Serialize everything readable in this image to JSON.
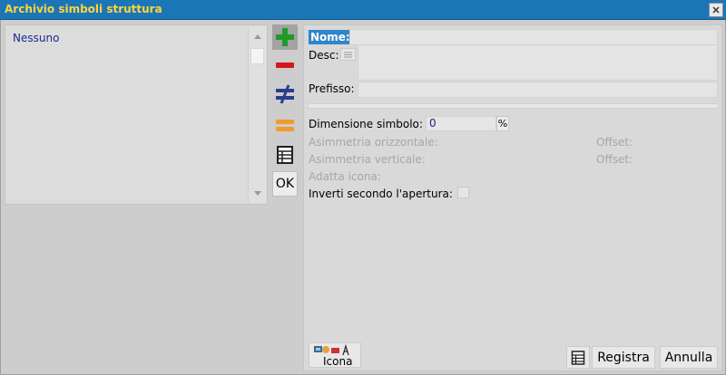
{
  "window": {
    "title": "Archivio simboli struttura"
  },
  "list": {
    "items": [
      "Nessuno"
    ]
  },
  "toolbar": {
    "ok_label": "OK"
  },
  "form": {
    "name_label": "Nome:",
    "name_value": "",
    "desc_label": "Desc:",
    "desc_value": "",
    "prefix_label": "Prefisso:",
    "prefix_value": "",
    "dimension_label": "Dimensione simbolo:",
    "dimension_value": "0",
    "dimension_unit": "%",
    "h_asym_label": "Asimmetria orizzontale:",
    "v_asym_label": "Asimmetria verticale:",
    "offset_label_1": "Offset:",
    "offset_label_2": "Offset:",
    "fit_icon_label": "Adatta icona:",
    "invert_label": "Inverti secondo l'apertura:"
  },
  "footer": {
    "icon_button_label": "Icona",
    "save_label": "Registra",
    "cancel_label": "Annulla"
  },
  "colors": {
    "titlebar": "#1b76b8",
    "title_text": "#ffd43c",
    "add_icon": "#1f9a2a",
    "remove_icon": "#d0181f",
    "not_equal_icon": "#283e8c",
    "equal_icon": "#f29b2f"
  }
}
